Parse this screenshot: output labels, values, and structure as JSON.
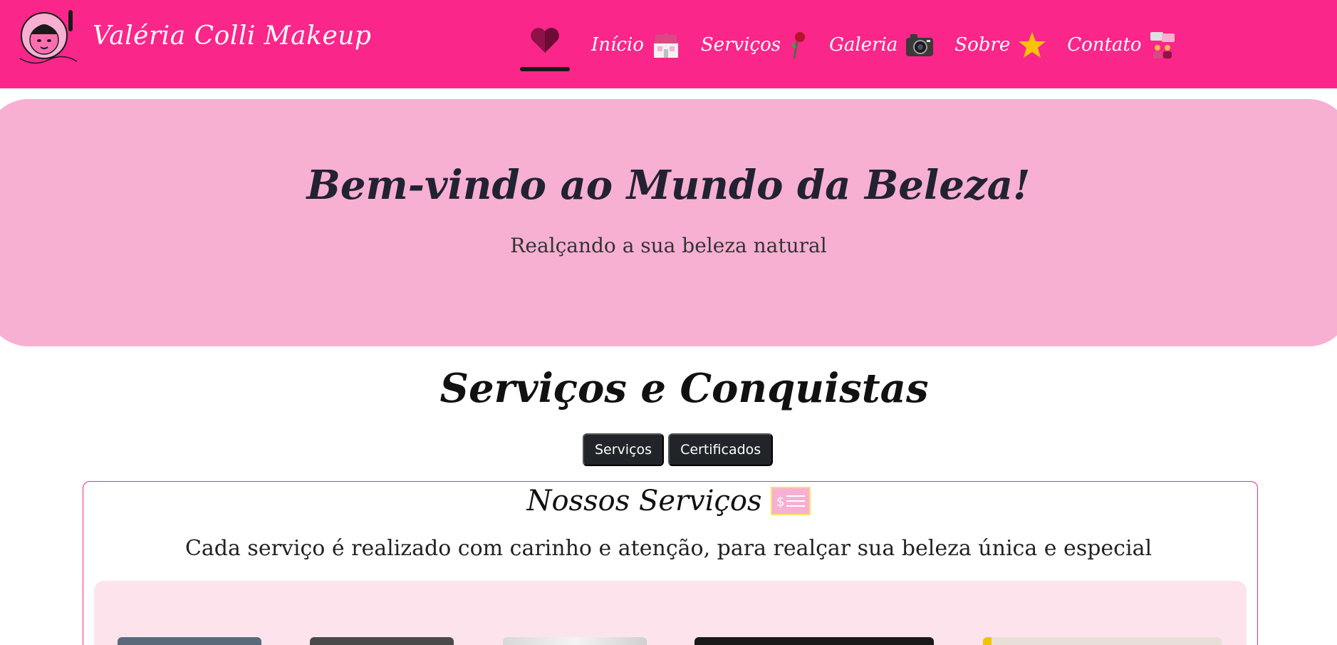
{
  "brand": {
    "name": "Valéria Colli Makeup",
    "logo_text": "Valéria Colli Makeup"
  },
  "nav": {
    "active_icon": "heart-icon",
    "items": [
      {
        "label": "Início",
        "icon": "house-icon"
      },
      {
        "label": "Serviços",
        "icon": "rose-icon"
      },
      {
        "label": "Galeria",
        "icon": "camera-icon"
      },
      {
        "label": "Sobre",
        "icon": "star-icon"
      },
      {
        "label": "Contato",
        "icon": "contact-icon"
      }
    ]
  },
  "hero": {
    "title": "Bem-vindo ao Mundo da Beleza!",
    "subtitle": "Realçando a sua beleza natural"
  },
  "section": {
    "title": "Serviços e Conquistas",
    "tabs": [
      "Serviços",
      "Certificados"
    ]
  },
  "services": {
    "title": "Nossos Serviços",
    "title_icon": "price-tag-icon",
    "description": "Cada serviço é realizado com carinho e atenção, para realçar sua beleza única e especial"
  },
  "colors": {
    "navbar": "#fa268a",
    "hero": "#f7b0d2",
    "gallery_bg": "#fde4ec",
    "tab_bg": "#212529"
  }
}
